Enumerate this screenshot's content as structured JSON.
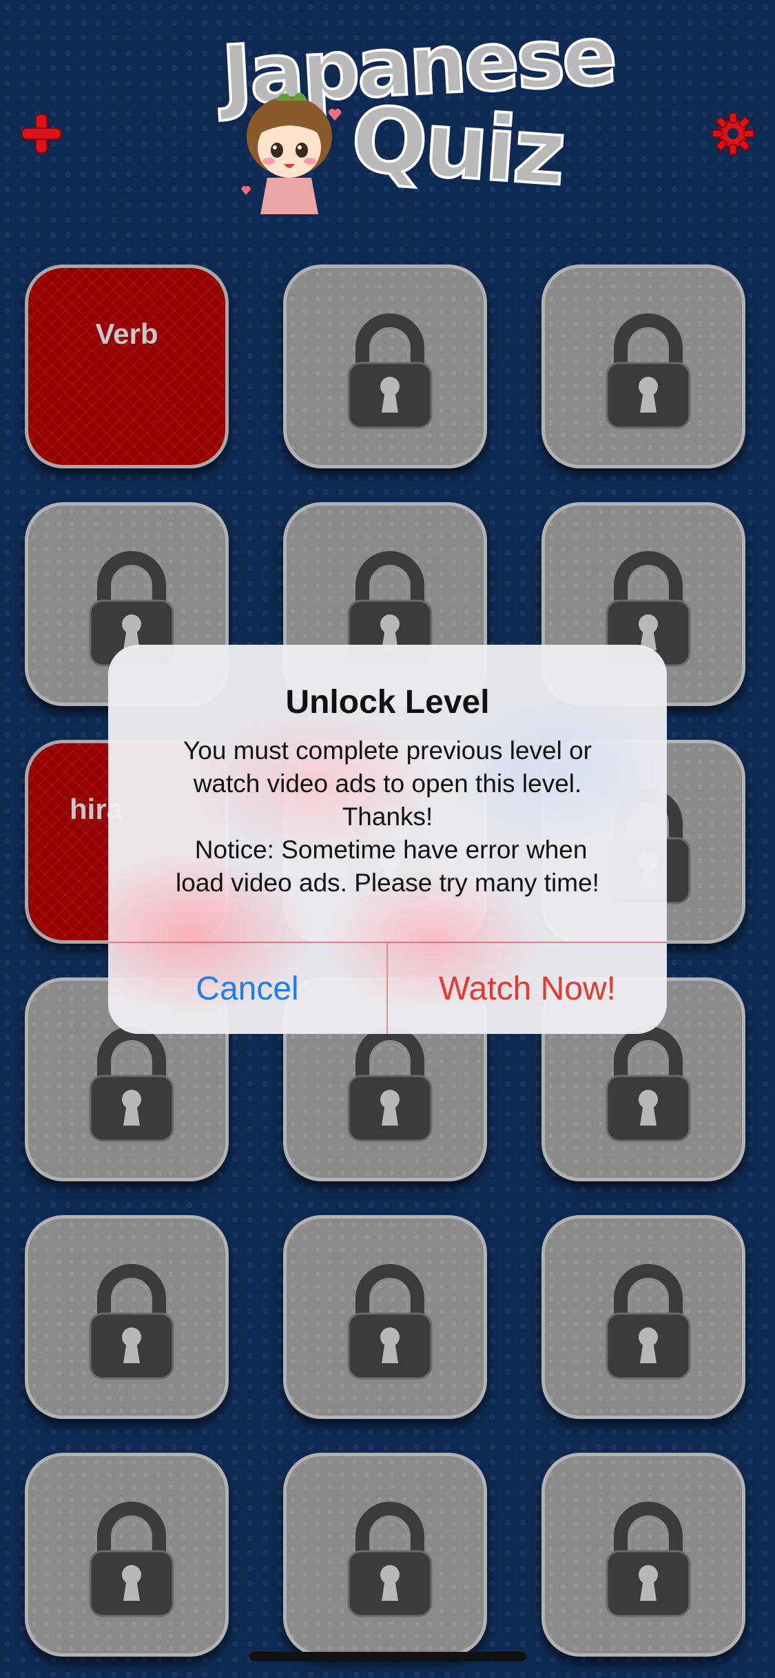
{
  "app": {
    "logo_text": "Japanese Quiz",
    "logo_line1": "Japanese",
    "logo_line2": "Quiz"
  },
  "header": {
    "add_icon": "plus-icon",
    "settings_icon": "gear-icon"
  },
  "tiles": [
    {
      "label": "Verb",
      "state": "open"
    },
    {
      "label": "",
      "state": "locked"
    },
    {
      "label": "",
      "state": "locked"
    },
    {
      "label": "",
      "state": "locked"
    },
    {
      "label": "",
      "state": "locked"
    },
    {
      "label": "",
      "state": "locked"
    },
    {
      "label": "hira",
      "state": "open"
    },
    {
      "label": "",
      "state": "locked"
    },
    {
      "label": "",
      "state": "locked"
    },
    {
      "label": "",
      "state": "locked"
    },
    {
      "label": "",
      "state": "locked"
    },
    {
      "label": "",
      "state": "locked"
    },
    {
      "label": "",
      "state": "locked"
    },
    {
      "label": "",
      "state": "locked"
    },
    {
      "label": "",
      "state": "locked"
    },
    {
      "label": "",
      "state": "locked"
    },
    {
      "label": "",
      "state": "locked"
    },
    {
      "label": "",
      "state": "locked"
    }
  ],
  "alert": {
    "title": "Unlock Level",
    "message_lines": [
      "You must complete previous level or",
      "watch video ads to open this level.",
      "Thanks!",
      " Notice: Sometime have error when",
      "load video ads. Please try many time!"
    ],
    "cancel_label": "Cancel",
    "confirm_label": "Watch Now!"
  },
  "colors": {
    "background": "#0f2a52",
    "tile_locked": "#8a8a8a",
    "tile_open": "#970000",
    "accent_red": "#e6392e",
    "ios_blue": "#1a7ff2"
  }
}
